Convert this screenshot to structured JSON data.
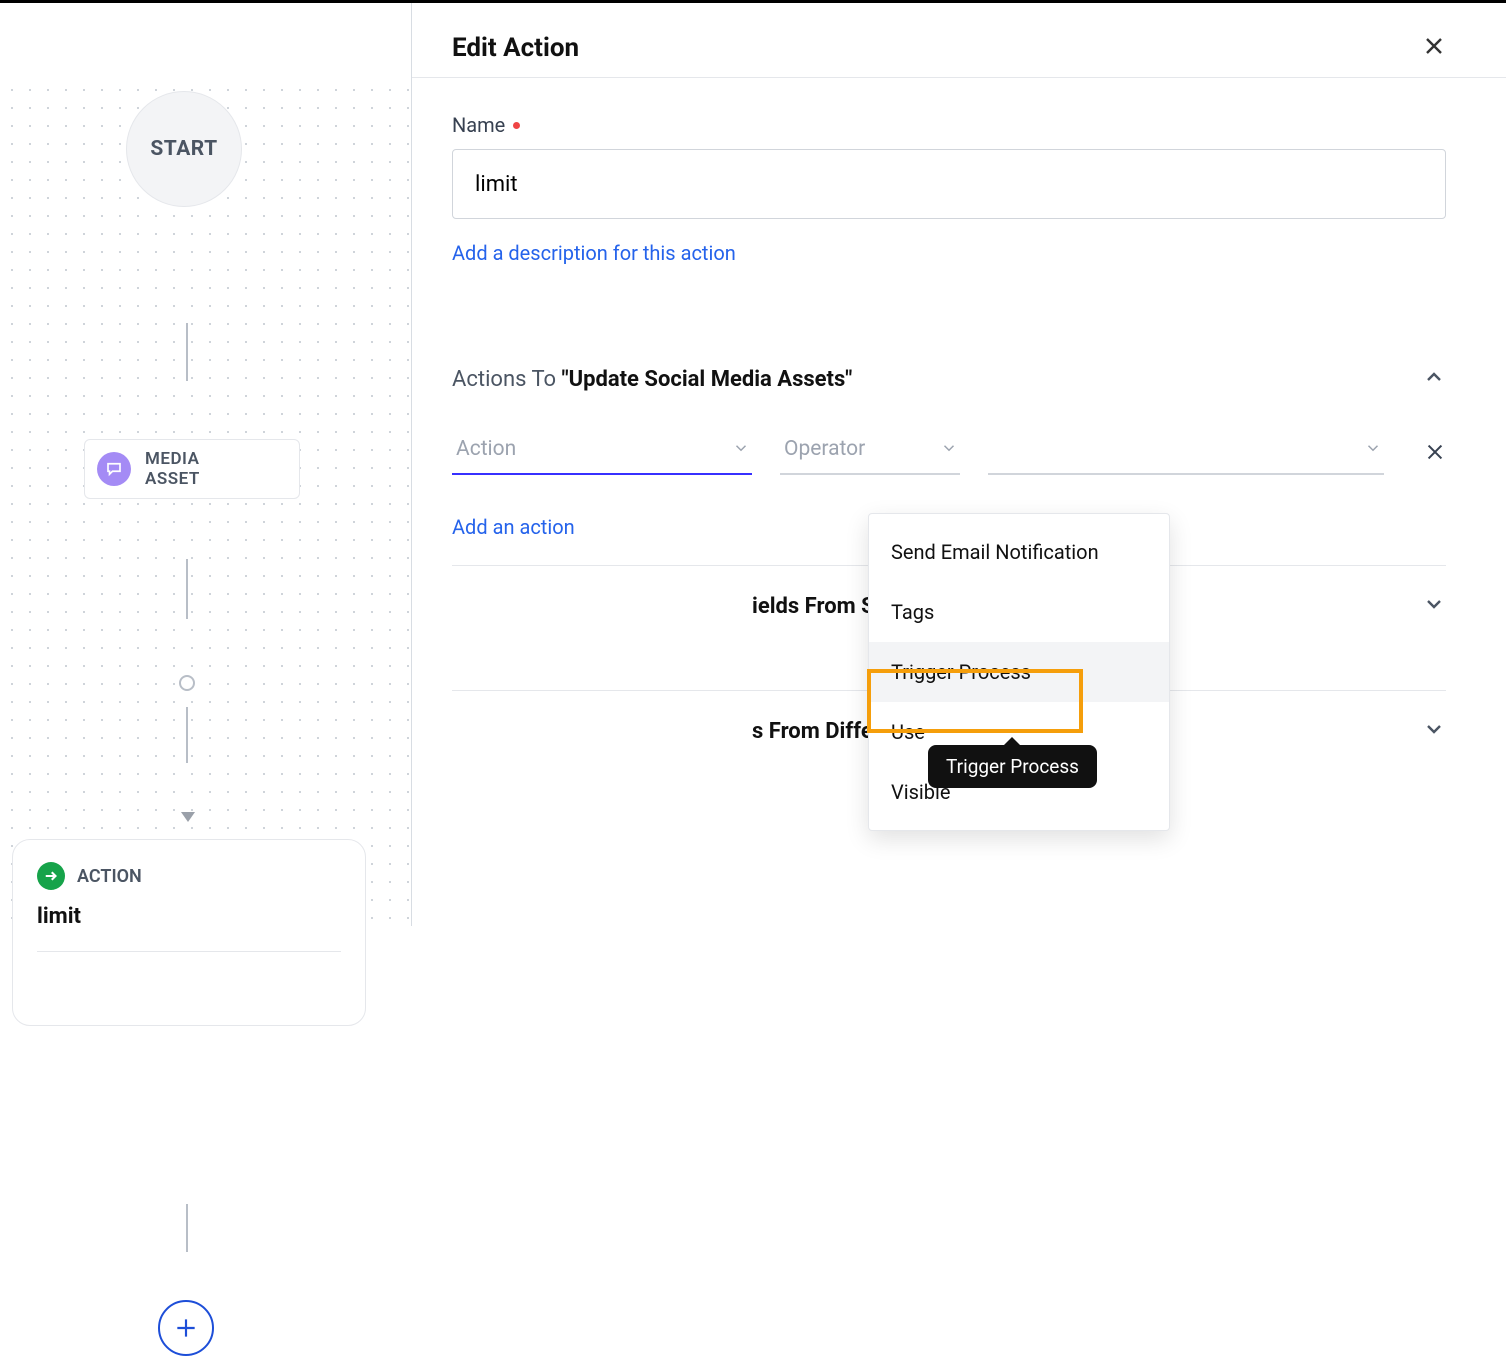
{
  "canvas": {
    "start_label": "START",
    "media_label_line1": "MEDIA",
    "media_label_line2": "ASSET",
    "action_header": "ACTION",
    "action_name": "limit"
  },
  "pane": {
    "title": "Edit Action",
    "name_label": "Name",
    "name_value": "limit",
    "desc_link": "Add a description for this action"
  },
  "section1": {
    "prefix": "Actions To ",
    "quoted": "\"Update Social Media Assets\"",
    "action_placeholder": "Action",
    "operator_placeholder": "Operator",
    "add_action_link": "Add an action"
  },
  "section2": {
    "visible_text": "ields From Similar Assets\""
  },
  "section3": {
    "visible_text": "s From Different Assets\""
  },
  "dropdown": {
    "items": [
      "Send Email Notification",
      "Tags",
      "Trigger Process",
      "Use",
      "Visible"
    ],
    "highlight_index": 2,
    "tooltip": "Trigger Process"
  }
}
